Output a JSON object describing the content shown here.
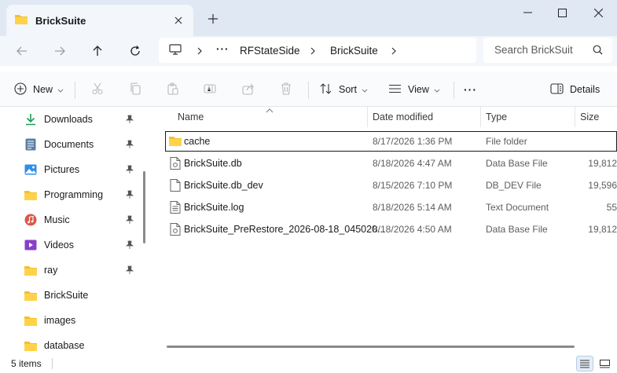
{
  "window": {
    "tab_title": "BrickSuite",
    "minimize_icon": "minimize-icon",
    "maximize_icon": "maximize-icon",
    "close_icon": "close-icon"
  },
  "address": {
    "breadcrumbs": [
      "RFStateSide",
      "BrickSuite"
    ],
    "ellipsis": "···"
  },
  "search": {
    "placeholder": "Search BrickSuit"
  },
  "toolbar": {
    "new_label": "New",
    "sort_label": "Sort",
    "view_label": "View",
    "more_label": "···",
    "details_label": "Details"
  },
  "sidebar": {
    "items": [
      {
        "label": "Downloads",
        "icon": "download-icon",
        "pinned": true
      },
      {
        "label": "Documents",
        "icon": "documents-icon",
        "pinned": true
      },
      {
        "label": "Pictures",
        "icon": "pictures-icon",
        "pinned": true
      },
      {
        "label": "Programming",
        "icon": "folder-icon",
        "pinned": true
      },
      {
        "label": "Music",
        "icon": "music-icon",
        "pinned": true
      },
      {
        "label": "Videos",
        "icon": "videos-icon",
        "pinned": true
      },
      {
        "label": "ray",
        "icon": "folder-icon",
        "pinned": true
      },
      {
        "label": "BrickSuite",
        "icon": "folder-icon",
        "pinned": false
      },
      {
        "label": "images",
        "icon": "folder-icon",
        "pinned": false
      },
      {
        "label": "database",
        "icon": "folder-icon",
        "pinned": false
      }
    ]
  },
  "columns": {
    "name": "Name",
    "date": "Date modified",
    "type": "Type",
    "size": "Size"
  },
  "files": [
    {
      "name": "cache",
      "date": "8/17/2026 1:36 PM",
      "type": "File folder",
      "size": "",
      "icon": "folder-icon"
    },
    {
      "name": "BrickSuite.db",
      "date": "8/18/2026 4:47 AM",
      "type": "Data Base File",
      "size": "19,812",
      "icon": "db-file-icon"
    },
    {
      "name": "BrickSuite.db_dev",
      "date": "8/15/2026 7:10 PM",
      "type": "DB_DEV File",
      "size": "19,596",
      "icon": "file-icon"
    },
    {
      "name": "BrickSuite.log",
      "date": "8/18/2026 5:14 AM",
      "type": "Text Document",
      "size": "55",
      "icon": "text-file-icon"
    },
    {
      "name": "BrickSuite_PreRestore_2026-08-18_045020...",
      "date": "8/18/2026 4:50 AM",
      "type": "Data Base File",
      "size": "19,812",
      "icon": "db-file-icon"
    }
  ],
  "status": {
    "item_count": "5 items"
  },
  "colors": {
    "accent": "#0067c0",
    "folder": "#f2c12e",
    "titlebar": "#dfe8f3"
  }
}
